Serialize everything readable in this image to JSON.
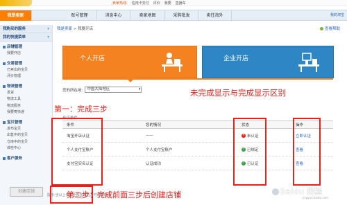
{
  "top_links": {
    "hot": "卖家热线:",
    "items": [
      "信用卡支付",
      "评价",
      "我要",
      "直播车"
    ]
  },
  "nav": {
    "tabs": [
      "我是卖家",
      "账号管理",
      "消息中心",
      "卖家地图",
      "采购批发",
      "卖往海外"
    ],
    "active_index": 0,
    "right_link": "我的淘宝"
  },
  "sidebar": {
    "sections": [
      {
        "title": "我购买的服务",
        "chevron": "▾"
      },
      {
        "title": "我的快捷菜单",
        "chevron": "▾"
      }
    ],
    "groups": [
      {
        "title": "店铺管理",
        "items": [
          "我要开店"
        ]
      },
      {
        "title": "交易管理",
        "items": [
          "已卖出的宝贝",
          "评价管理"
        ]
      },
      {
        "title": "物流管理",
        "items": [
          "发货",
          "物流工具",
          "物流服务",
          "我要寄快递"
        ]
      },
      {
        "title": "宝贝管理",
        "items": [
          "发布宝贝",
          "出售中的宝贝",
          "仓库中的宝贝",
          "体检中心"
        ]
      },
      {
        "title": "客户服务",
        "items": []
      }
    ]
  },
  "breadcrumb": {
    "link": "我是卖家",
    "sep": " > ",
    "current": "我要开店"
  },
  "help_link": "查看帮助",
  "banners": {
    "personal": "个人开店",
    "enterprise": "企业开店"
  },
  "location": {
    "label": "您的所在地:",
    "value": "中国大陆地区"
  },
  "annotations": {
    "diff": "未完成显示与完成显示区别",
    "step1": "第一：完成三步",
    "step2": "第二步：完成前面三步后创建店铺"
  },
  "conditions_label": "开店条件:",
  "table": {
    "headers": [
      "条件",
      "您的情况",
      "状态",
      "操作"
    ],
    "rows": [
      {
        "condition": "淘宝开店认证",
        "situation": "——",
        "status": "未认证",
        "status_type": "error",
        "action": "立即认证"
      },
      {
        "condition": "个人支付宝账户",
        "situation": "个人支付宝账户",
        "status": "已绑定",
        "status_type": "ok",
        "action": "查看"
      },
      {
        "condition": "支付宝实名认证",
        "situation": "认证成功",
        "status": "已认证",
        "status_type": "ok",
        "action": "查看"
      }
    ]
  },
  "create_button": "创建店铺",
  "note": "提示:当以上条件全部完成后方可创建店铺",
  "watermark": {
    "main": "Baidu 经验",
    "sub": "jingyan.baidu.com"
  },
  "colors": {
    "orange": "#f58220",
    "blue": "#2f86c4",
    "red_annotation": "#e8201b",
    "ok_green": "#39a244"
  }
}
